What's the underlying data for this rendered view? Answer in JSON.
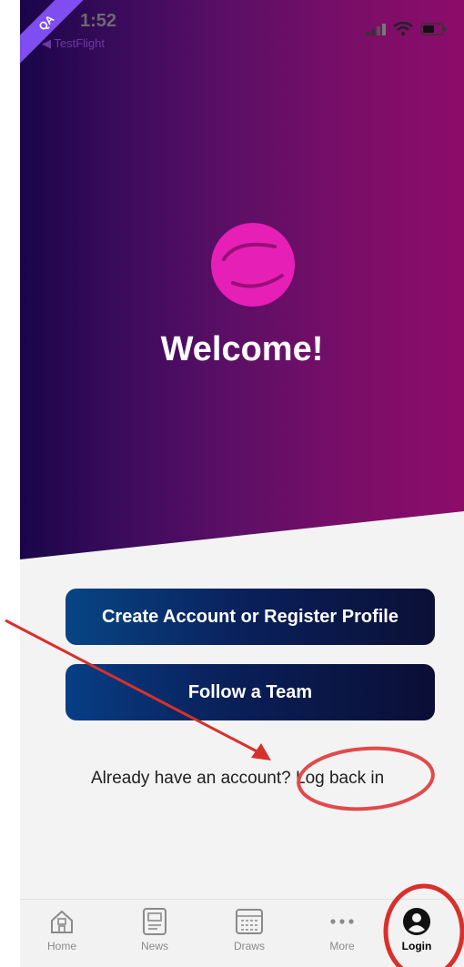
{
  "status_bar": {
    "time": "1:52",
    "back_app": "◀ TestFlight",
    "qa_badge": "QA"
  },
  "welcome": {
    "title": "Welcome!"
  },
  "actions": {
    "create_label": "Create Account or Register Profile",
    "follow_label": "Follow a Team",
    "already_text": "Already have an account?",
    "login_link": "Log back in"
  },
  "tabs": [
    {
      "label": "Home",
      "icon": "home-icon"
    },
    {
      "label": "News",
      "icon": "news-icon"
    },
    {
      "label": "Draws",
      "icon": "draws-icon"
    },
    {
      "label": "More",
      "icon": "more-icon"
    },
    {
      "label": "Login",
      "icon": "user-icon"
    }
  ],
  "colors": {
    "brand_pink": "#e61fb6",
    "hero_start": "#1a0548",
    "hero_end": "#8d0c6a",
    "button_blue": "#0a1f5a",
    "annotation_red": "#d9302b"
  }
}
